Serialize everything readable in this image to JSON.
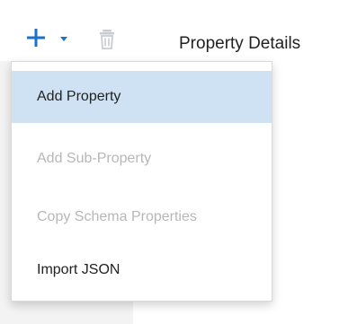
{
  "toolbar": {
    "add_icon": "plus-icon",
    "dropdown_icon": "caret-down-icon",
    "delete_icon": "trash-icon",
    "title": "Property Details"
  },
  "menu": {
    "items": [
      {
        "label": "Add Property",
        "enabled": true,
        "highlighted": true
      },
      {
        "label": "Add Sub-Property",
        "enabled": false,
        "highlighted": false
      },
      {
        "label": "Copy Schema Properties",
        "enabled": false,
        "highlighted": false
      },
      {
        "label": "Import JSON",
        "enabled": true,
        "highlighted": false
      }
    ]
  },
  "colors": {
    "accent": "#1a73c8",
    "highlight": "#cfe2f3",
    "disabled_text": "#b7b7b7",
    "trash_icon": "#c7ccd1",
    "side_panel": "#f3f3f3"
  }
}
